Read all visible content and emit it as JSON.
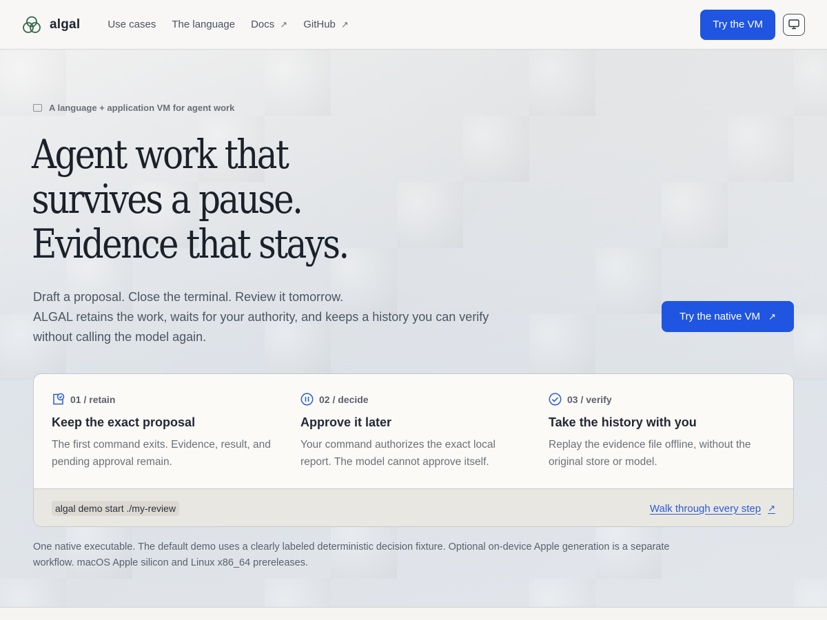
{
  "brand": {
    "name": "algal"
  },
  "nav": [
    {
      "label": "Use cases",
      "external": false
    },
    {
      "label": "The language",
      "external": false
    },
    {
      "label": "Docs",
      "external": true
    },
    {
      "label": "GitHub",
      "external": true
    }
  ],
  "header": {
    "cta_label": "Try the VM",
    "monitor_icon": "monitor-icon"
  },
  "hero": {
    "eyebrow": "A language + application VM for agent work",
    "headline": [
      "Agent work that",
      "survives a pause.",
      "Evidence that stays."
    ],
    "lede": [
      "Draft a proposal. Close the terminal. Review it tomorrow.",
      "ALGAL retains the work, waits for your authority, and keeps a history you can verify",
      "without calling the model again."
    ],
    "cta_label": "Try the native VM"
  },
  "steps": [
    {
      "tag": "01 / retain",
      "icon": "retain-icon",
      "title": "Keep the exact proposal",
      "body": "The first command exits. Evidence, result, and pending approval remain."
    },
    {
      "tag": "02 / decide",
      "icon": "pause-icon",
      "title": "Approve it later",
      "body": "Your command authorizes the exact local report. The model cannot approve itself."
    },
    {
      "tag": "03 / verify",
      "icon": "check-circle-icon",
      "title": "Take the history with you",
      "body": "Replay the evidence file offline, without the original store or model."
    }
  ],
  "card_footer": {
    "command": "algal demo start ./my-review",
    "walkthrough_label": "Walk through every step"
  },
  "footnote": "One native executable. The default demo uses a clearly labeled deterministic decision fixture. Optional on-device Apple generation is a separate workflow. macOS Apple silicon and Linux x86_64 prereleases.",
  "colors": {
    "accent": "#1f55e0",
    "link": "#2d5bd6",
    "icon_blue": "#2a5bd8"
  }
}
